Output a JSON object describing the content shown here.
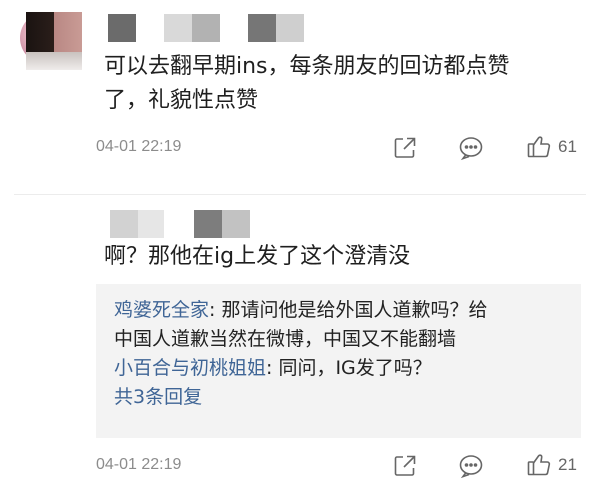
{
  "comments": [
    {
      "text_line1": "可以去翻早期ins，每条朋友的回访都点赞",
      "text_line2": "了，礼貌性点赞",
      "time": "04-01 22:19",
      "likes": "61",
      "name_pixels": [
        "#6b6b6b",
        "#d9d9d9",
        "#b2b2b2",
        "#767676",
        "#cfcfcf"
      ]
    },
    {
      "text": "啊？那他在ig上发了这个澄清没",
      "time": "04-01 22:19",
      "likes": "21",
      "name_pixels": [
        "#d2d2d2",
        "#e6e6e6",
        "#7d7d7d",
        "#c2c2c2"
      ],
      "replies": [
        {
          "user": "鸡婆死全家",
          "text_line1": ": 那请问他是给外国人道歉吗？给",
          "text_line2": "中国人道歉当然在微博，中国又不能翻墙"
        },
        {
          "user": "小百合与初桃姐姐",
          "text_line1": ": 同问，IG发了吗？"
        }
      ],
      "more_replies": "共3条回复"
    }
  ],
  "icons": [
    "share-icon",
    "comment-icon",
    "like-icon"
  ]
}
